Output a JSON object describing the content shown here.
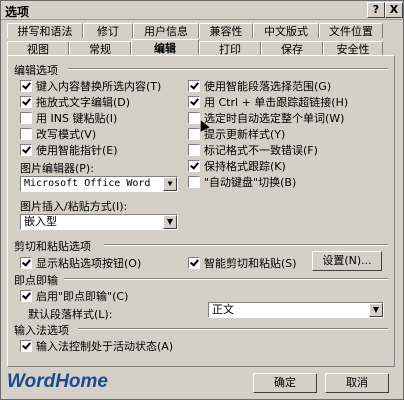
{
  "title": "选项",
  "title_buttons": {
    "help": "?",
    "close": "X"
  },
  "tabs_row1": [
    "拼写和语法",
    "修订",
    "用户信息",
    "兼容性",
    "中文版式",
    "文件位置"
  ],
  "tabs_row2": [
    "视图",
    "常规",
    "编辑",
    "打印",
    "保存",
    "安全性"
  ],
  "active_tab": "编辑",
  "editing": {
    "section": "编辑选项",
    "left": [
      {
        "label": "键入内容替换所选内容(T)",
        "checked": true
      },
      {
        "label": "拖放式文字编辑(D)",
        "checked": true
      },
      {
        "label": "用 INS 键粘贴(I)",
        "checked": false
      },
      {
        "label": "改写模式(V)",
        "checked": false
      },
      {
        "label": "使用智能指针(E)",
        "checked": true
      }
    ],
    "right": [
      {
        "label": "使用智能段落选择范围(G)",
        "checked": true
      },
      {
        "label": "用 Ctrl + 单击跟踪超链接(H)",
        "checked": true
      },
      {
        "label": "选定时自动选定整个单词(W)",
        "checked": false
      },
      {
        "label": "提示更新样式(Y)",
        "checked": false
      },
      {
        "label": "标记格式不一致错误(F)",
        "checked": false
      },
      {
        "label": "保持格式跟踪(K)",
        "checked": true
      },
      {
        "label": "\"自动键盘\"切换(B)",
        "checked": false
      }
    ],
    "picture_editor_label": "图片编辑器(P):",
    "picture_editor_value": "Microsoft Office Word",
    "insert_paste_label": "图片插入/粘贴方式(I):",
    "insert_paste_value": "嵌入型"
  },
  "cut_paste": {
    "section": "剪切和粘贴选项",
    "show_paste_options": {
      "label": "显示粘贴选项按钮(O)",
      "checked": true
    },
    "smart_cut_paste": {
      "label": "智能剪切和粘贴(S)",
      "checked": true
    },
    "settings_button": "设置(N)..."
  },
  "click_and_type": {
    "section": "即点即输",
    "enable": {
      "label": "启用\"即点即输\"(C)",
      "checked": true
    },
    "default_style_label": "默认段落样式(L):",
    "default_style_value": "正文"
  },
  "ime": {
    "section": "输入法选项",
    "ime_control": {
      "label": "输入法控制处于活动状态(A)",
      "checked": true
    }
  },
  "ok_button": "确定",
  "cancel_button": "取消",
  "watermark": "WordHome"
}
